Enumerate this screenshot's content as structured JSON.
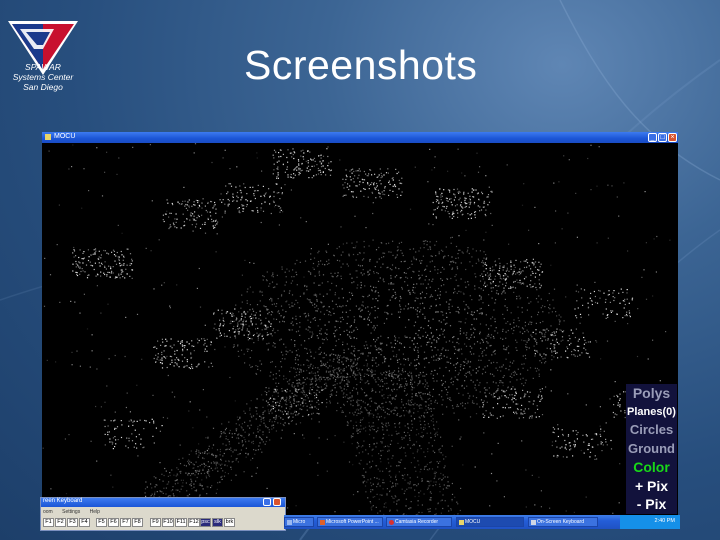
{
  "logo": {
    "org_lines": [
      "SPAWAR",
      "Systems Center",
      "San Diego"
    ],
    "colors": {
      "red": "#c8102e",
      "blue": "#1a3a8c",
      "white": "#ffffff"
    }
  },
  "slide": {
    "title": "Screenshots",
    "background_color": "#2f5a8c"
  },
  "app_window": {
    "title": "MOCU",
    "controls": [
      "minimize-icon",
      "maximize-icon",
      "close-icon"
    ],
    "scene": "lidar-point-cloud"
  },
  "side_menu": {
    "items": [
      "Polys",
      "Planes(0)",
      "Circles",
      "Ground",
      "Color",
      "+ Pix",
      "- Pix"
    ],
    "colors": {
      "background": "#12123c",
      "active": "#18d818",
      "inactive": "#9a9db8",
      "normal": "#ffffff"
    }
  },
  "on_screen_keyboard": {
    "title": "reen Keyboard",
    "menu": [
      "oom",
      "Settings",
      "Help"
    ],
    "keys": [
      "F1",
      "F2",
      "F3",
      "F4",
      "F5",
      "F6",
      "F7",
      "F8",
      "F9",
      "F10",
      "F11",
      "F12",
      "psc",
      "slk",
      "brk"
    ]
  },
  "taskbar": {
    "items": [
      "Micro",
      "Microsoft PowerPoint ...",
      "Camtasia Recorder",
      "MOCU",
      "On-Screen Keyboard"
    ],
    "clock": "2:40 PM"
  }
}
